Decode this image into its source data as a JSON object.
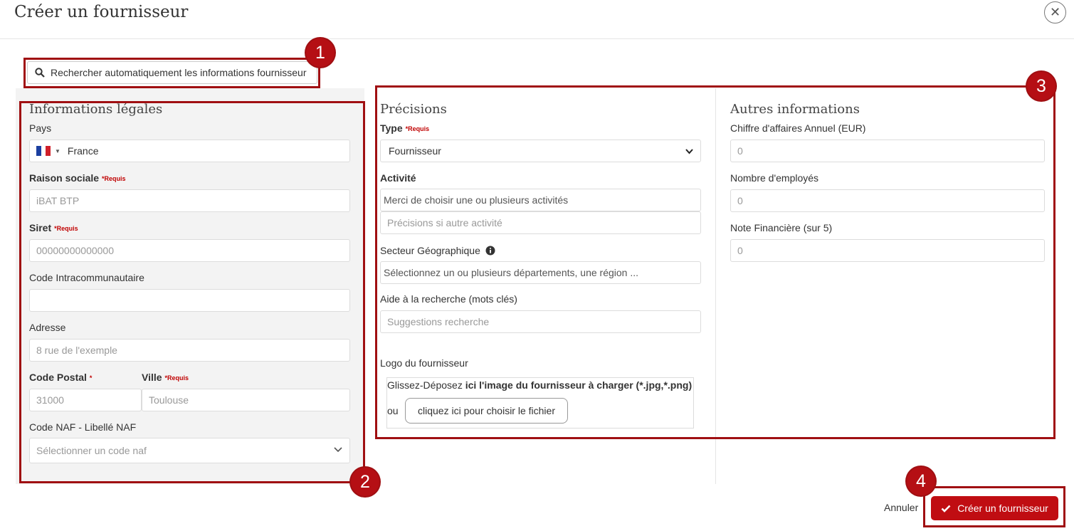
{
  "header": {
    "title": "Créer un fournisseur",
    "close_icon": "close-icon"
  },
  "search": {
    "label": "Rechercher automatiquement les informations fournisseur",
    "icon": "search-icon"
  },
  "legal": {
    "title": "Informations légales",
    "country": {
      "label": "Pays",
      "value": "France",
      "flag": "france-flag-icon"
    },
    "company_name": {
      "label": "Raison sociale",
      "required": "*Requis",
      "placeholder": "iBAT BTP"
    },
    "siret": {
      "label": "Siret",
      "required": "*Requis",
      "placeholder": "00000000000000"
    },
    "vat_code": {
      "label": "Code Intracommunautaire",
      "value": ""
    },
    "address": {
      "label": "Adresse",
      "placeholder": "8 rue de l'exemple"
    },
    "postal_code": {
      "label": "Code Postal",
      "required": "*",
      "placeholder": "31000"
    },
    "city": {
      "label": "Ville",
      "required": "*Requis",
      "placeholder": "Toulouse"
    },
    "naf": {
      "label": "Code NAF - Libellé NAF",
      "placeholder": "Sélectionner un code naf"
    }
  },
  "details": {
    "title": "Précisions",
    "type": {
      "label": "Type",
      "required": "*Requis",
      "value": "Fournisseur"
    },
    "activity": {
      "label": "Activité",
      "placeholder": "Merci de choisir une ou plusieurs activités",
      "other_placeholder": "Précisions si autre activité"
    },
    "sector": {
      "label": "Secteur Géographique",
      "info_icon": "info-icon",
      "placeholder": "Sélectionnez un ou plusieurs départements, une région ..."
    },
    "search_help": {
      "label": "Aide à la recherche (mots clés)",
      "placeholder": "Suggestions recherche"
    },
    "logo": {
      "label": "Logo du fournisseur",
      "drop_prefix": "Glissez-Déposez ",
      "drop_bold": "ici l'image du fournisseur à charger",
      "drop_suffix": " (*.jpg,*.png)",
      "or": "ou",
      "button": "cliquez ici pour choisir le fichier"
    }
  },
  "other": {
    "title": "Autres informations",
    "revenue": {
      "label": "Chiffre d'affaires Annuel (EUR)",
      "placeholder": "0"
    },
    "employees": {
      "label": "Nombre d'employés",
      "placeholder": "0"
    },
    "rating": {
      "label": "Note Financière (sur 5)",
      "placeholder": "0"
    }
  },
  "annotations": {
    "b1": "1",
    "b2": "2",
    "b3": "3",
    "b4": "4"
  },
  "footer": {
    "cancel": "Annuler",
    "create": "Créer un fournisseur"
  },
  "colors": {
    "accent": "#c00d12",
    "annotation": "#a00f12",
    "panel": "#f3f3f3"
  }
}
